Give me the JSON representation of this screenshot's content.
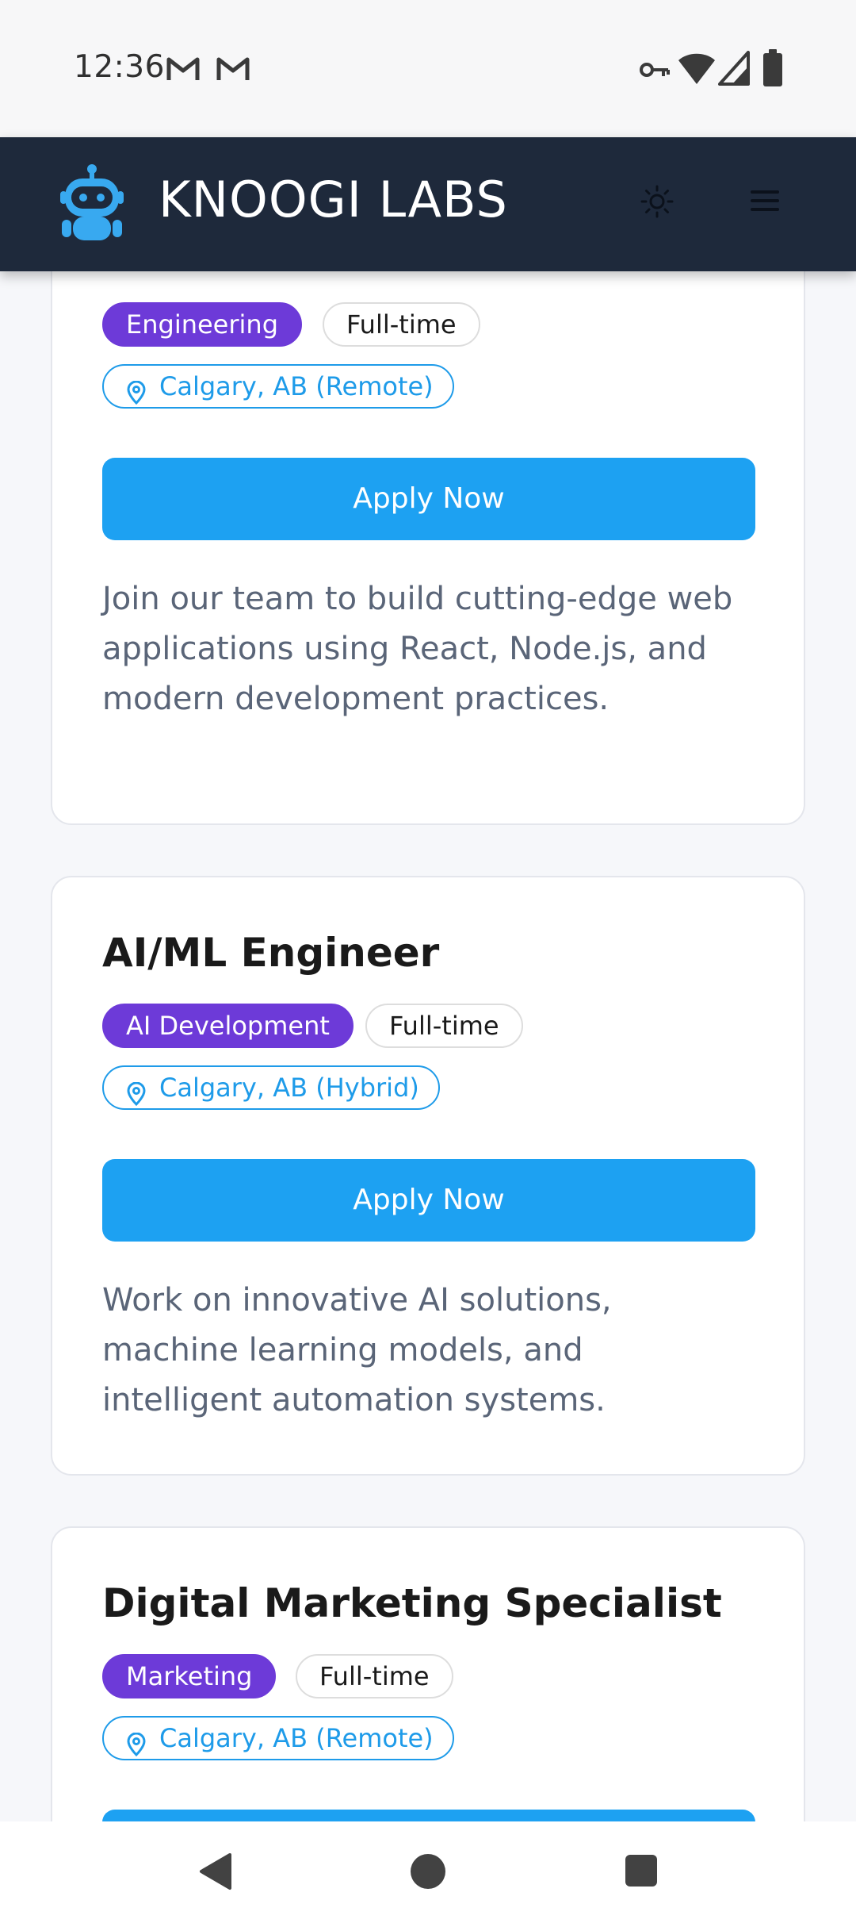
{
  "status_bar": {
    "time": "12:36",
    "left_icons": [
      "gmail-icon",
      "gmail-icon"
    ],
    "right_icons": [
      "vpn-key-icon",
      "wifi-icon",
      "signal-icon",
      "battery-icon"
    ]
  },
  "header": {
    "brand": "KNOOGI LABS",
    "logo_icon": "robot-icon",
    "theme_icon": "sun-icon",
    "menu_icon": "hamburger-menu-icon"
  },
  "jobs": [
    {
      "title": "",
      "department": "Engineering",
      "type": "Full-time",
      "location": "Calgary, AB (Remote)",
      "apply_label": "Apply Now",
      "description": "Join our team to build cutting-edge web applications using React, Node.js, and modern development practices."
    },
    {
      "title": "AI/ML Engineer",
      "department": "AI Development",
      "type": "Full-time",
      "location": "Calgary, AB (Hybrid)",
      "apply_label": "Apply Now",
      "description": "Work on innovative AI solutions, machine learning models, and intelligent automation systems."
    },
    {
      "title": "Digital Marketing Specialist",
      "department": "Marketing",
      "type": "Full-time",
      "location": "Calgary, AB (Remote)",
      "apply_label": "Apply Now",
      "description": ""
    }
  ],
  "colors": {
    "header_bg": "#1e293b",
    "department_pill": "#6d3ad8",
    "accent_blue": "#1da1f2",
    "location_blue": "#1e9be9"
  },
  "nav_bar": {
    "icons": [
      "back-triangle-icon",
      "home-circle-icon",
      "recents-square-icon"
    ]
  }
}
